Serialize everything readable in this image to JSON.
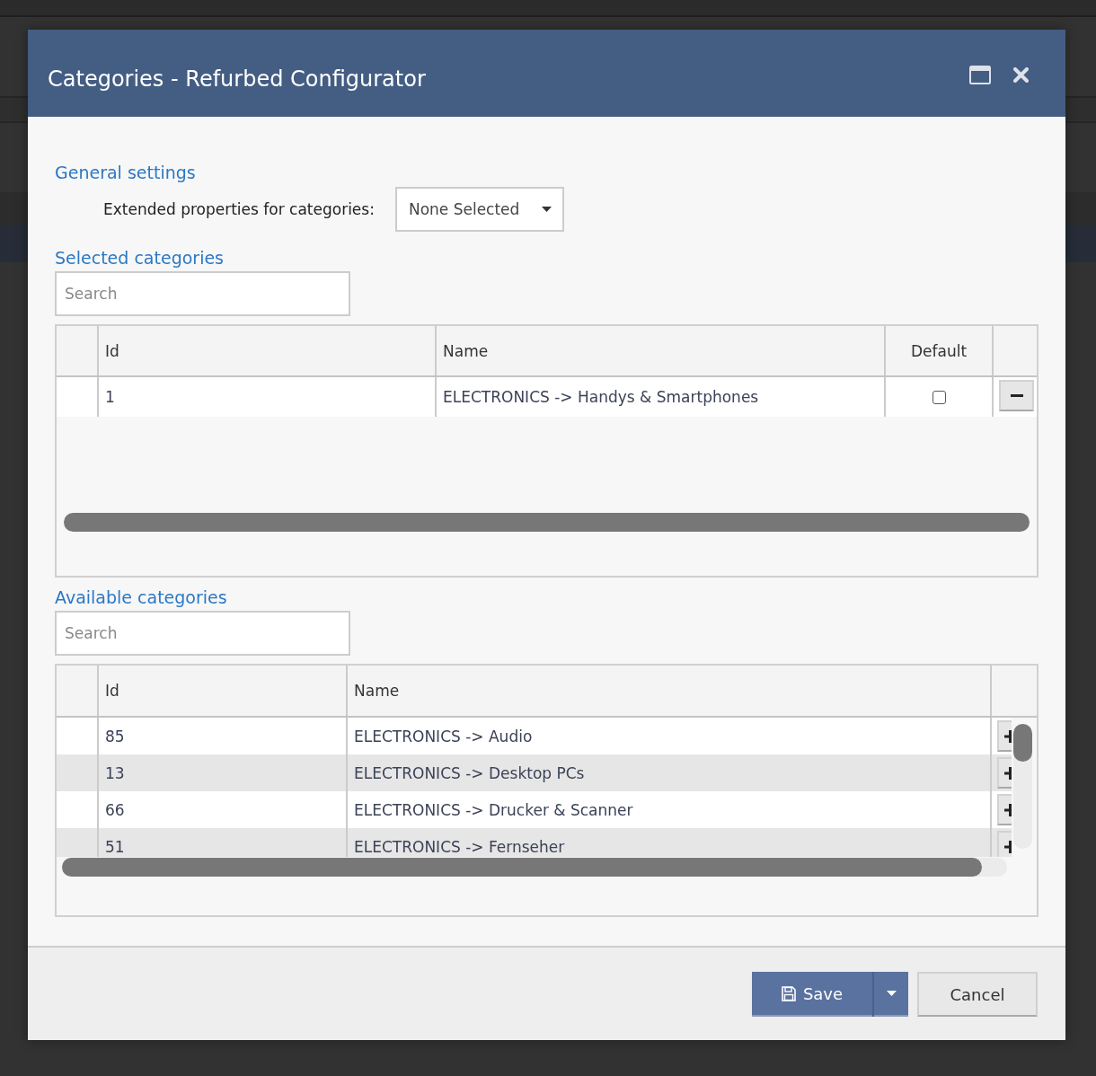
{
  "window": {
    "title": "Categories - Refurbed Configurator"
  },
  "general_settings": {
    "heading": "General settings",
    "field_label": "Extended properties for categories:",
    "dropdown": {
      "value": "None Selected"
    }
  },
  "selected_categories": {
    "heading": "Selected categories",
    "search": {
      "placeholder": "Search"
    },
    "columns": [
      "Id",
      "Name",
      "Default"
    ],
    "rows": [
      {
        "id": "1",
        "name": "ELECTRONICS -> Handys & Smartphones",
        "default": false
      }
    ]
  },
  "available_categories": {
    "heading": "Available categories",
    "search": {
      "placeholder": "Search"
    },
    "columns": [
      "Id",
      "Name"
    ],
    "rows": [
      {
        "id": "85",
        "name": "ELECTRONICS -> Audio"
      },
      {
        "id": "13",
        "name": "ELECTRONICS -> Desktop PCs"
      },
      {
        "id": "66",
        "name": "ELECTRONICS -> Drucker & Scanner"
      },
      {
        "id": "51",
        "name": "ELECTRONICS -> Fernseher"
      }
    ]
  },
  "footer": {
    "buttons": [
      {
        "label": "Save",
        "kind": "primary"
      },
      {
        "label": "Cancel",
        "kind": "secondary"
      }
    ]
  }
}
